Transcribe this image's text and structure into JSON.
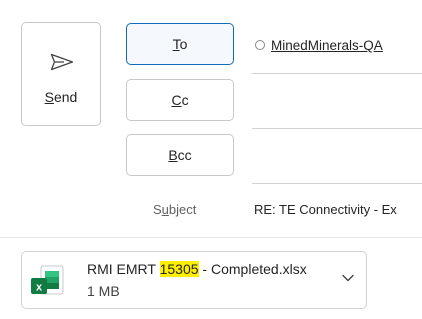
{
  "compose": {
    "send_label": "Send",
    "send_label_underline": "S",
    "send_label_rest": "end",
    "to": {
      "underline": "T",
      "rest": "o"
    },
    "cc": {
      "underline": "C",
      "rest": "c"
    },
    "bcc": {
      "underline": "B",
      "rest": "cc"
    },
    "to_recipient": "MinedMinerals-QA",
    "subject_label_pre": "S",
    "subject_label_u": "u",
    "subject_label_post": "bject",
    "subject_value": "RE: TE Connectivity - Ex"
  },
  "attachment": {
    "name_prefix": "RMI EMRT ",
    "name_highlight": "15305",
    "name_suffix": " - Completed.xlsx",
    "size": "1 MB",
    "icon": "excel-file-icon"
  },
  "colors": {
    "focus_border": "#0f6cbd",
    "highlight": "#ffef00",
    "excel_green": "#107c41"
  }
}
